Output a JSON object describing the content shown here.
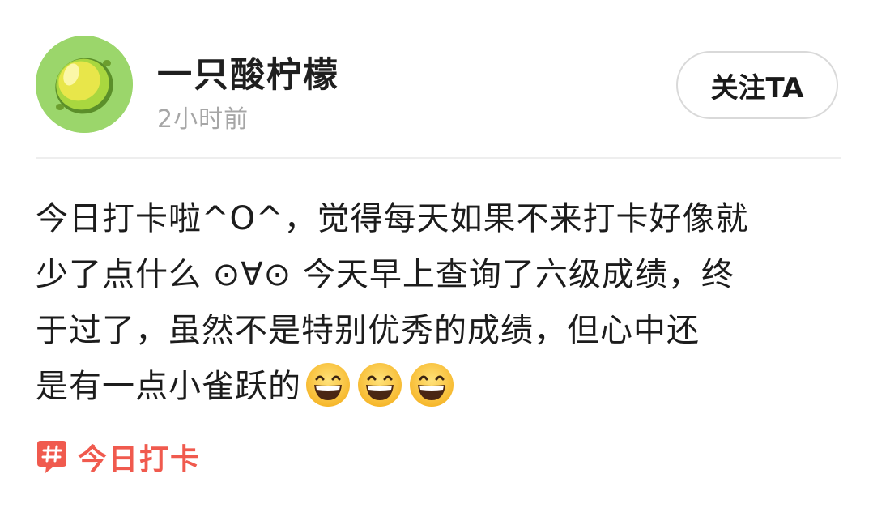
{
  "author": {
    "name": "一只酸柠檬",
    "time": "2小时前"
  },
  "follow_button": {
    "label": "关注TA"
  },
  "post": {
    "lines": [
      "今日打卡啦^O^，觉得每天如果不来打卡好像就",
      "少了点什么 ⊙∀⊙ 今天早上查询了六级成绩，终",
      "于过了，虽然不是特别优秀的成绩，但心中还",
      "是有一点小雀跃的"
    ],
    "trailing_emoji": [
      "grinning-face-emoji",
      "grinning-face-emoji",
      "grinning-face-emoji"
    ]
  },
  "topic": {
    "label": "今日打卡",
    "icon": "hashtag-icon"
  },
  "colors": {
    "avatar_bg": "#9bd66b",
    "topic_accent": "#f05a4e",
    "time_gray": "#a6a6a6"
  }
}
